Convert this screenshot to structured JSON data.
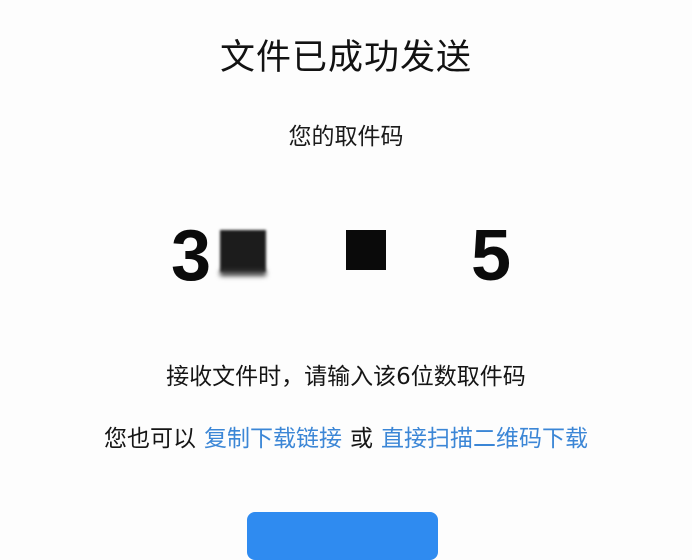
{
  "header": {
    "title": "文件已成功发送"
  },
  "code": {
    "label": "您的取件码",
    "visible_first_digit": "3",
    "visible_last_digit": "5",
    "redacted": true
  },
  "instructions": {
    "hint": "接收文件时，请输入该6位数取件码"
  },
  "alternatives": {
    "prefix": "您也可以",
    "copy_link": "复制下载链接",
    "or": "或",
    "scan_qr": "直接扫描二维码下载",
    "link_color": "#3b86d6"
  },
  "primary_button": {
    "color": "#2f8bf0"
  },
  "colors": {
    "background": "#fdfdfd",
    "text": "#111111"
  }
}
